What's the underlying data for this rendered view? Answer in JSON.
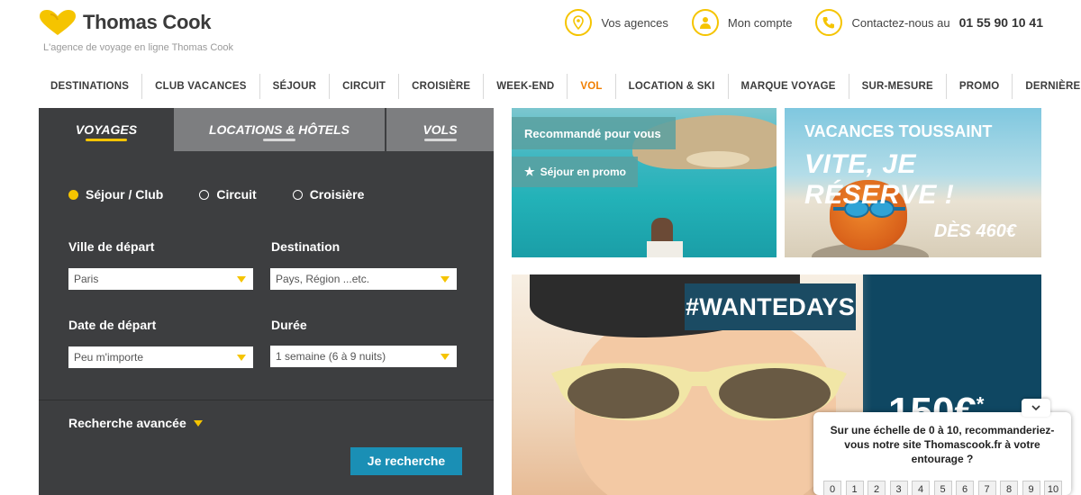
{
  "header": {
    "brand": "Thomas Cook",
    "tagline": "L'agence de voyage en ligne Thomas Cook",
    "links": {
      "agencies": "Vos agences",
      "account": "Mon compte",
      "contact": "Contactez-nous au",
      "phone": "01 55 90 10 41"
    }
  },
  "nav": {
    "items": [
      "DESTINATIONS",
      "CLUB VACANCES",
      "SÉJOUR",
      "CIRCUIT",
      "CROISIÈRE",
      "WEEK-END",
      "VOL",
      "LOCATION & SKI",
      "MARQUE VOYAGE",
      "SUR-MESURE",
      "PROMO",
      "DERNIÈRE MINUTE"
    ],
    "active_index": 6
  },
  "search": {
    "tabs": [
      "VOYAGES",
      "LOCATIONS & HÔTELS",
      "VOLS"
    ],
    "types": [
      "Séjour / Club",
      "Circuit",
      "Croisière"
    ],
    "selected_type": "Séjour / Club",
    "departure_city": {
      "label": "Ville de départ",
      "value": "Paris"
    },
    "destination": {
      "label": "Destination",
      "value": "Pays, Région ...etc."
    },
    "departure_date": {
      "label": "Date de départ",
      "value": "Peu m'importe"
    },
    "duration": {
      "label": "Durée",
      "value": "1 semaine (6 à 9 nuits)"
    },
    "advanced": "Recherche avancée",
    "submit": "Je recherche"
  },
  "promos": {
    "beach": {
      "badge": "Recommandé pour vous",
      "tag": "Séjour en promo"
    },
    "toussaint": {
      "title": "VACANCES TOUSSAINT",
      "slogan": "VITE, JE RÉSERVE !",
      "price": "DÈS 460€"
    },
    "wante": {
      "hashtag": "#WANTEDAYS",
      "price": "150€",
      "price_suffix": "*"
    }
  },
  "survey": {
    "question": "Sur une échelle de 0 à 10, recommanderiez-vous notre site Thomascook.fr à votre entourage ?",
    "scores": [
      "0",
      "1",
      "2",
      "3",
      "4",
      "5",
      "6",
      "7",
      "8",
      "9",
      "10"
    ]
  },
  "colors": {
    "brand_yellow": "#f5c400",
    "nav_active": "#f07e00",
    "panel_bg": "#3d3e40",
    "button_blue": "#1a8fb5"
  }
}
